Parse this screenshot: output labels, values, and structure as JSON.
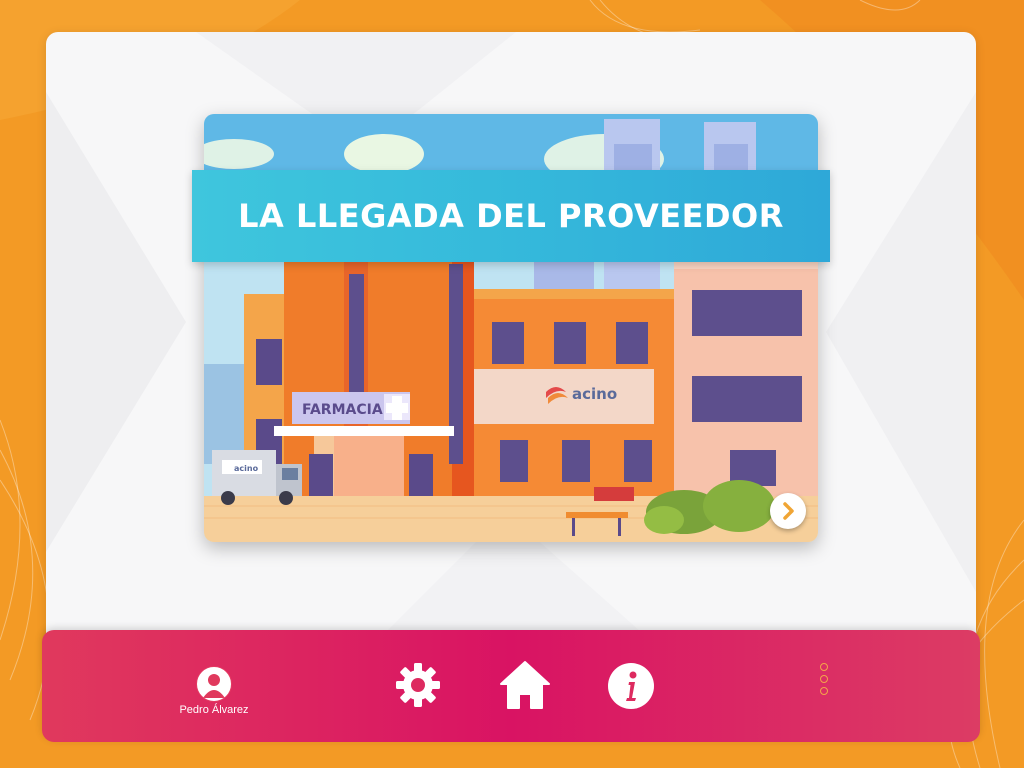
{
  "card": {
    "title": "LA LLEGADA DEL PROVEEDOR",
    "pharmacy_sign": "FARMACIA",
    "company_sign": "acino",
    "truck_sign": "acino"
  },
  "footer": {
    "user_name": "Pedro Álvarez"
  },
  "icons": {
    "avatar": "user-avatar-icon",
    "settings": "gear-icon",
    "home": "home-icon",
    "info": "info-icon",
    "next": "chevron-right-icon",
    "menu": "vertical-dots-icon"
  },
  "colors": {
    "background": "#f39a25",
    "banner": "#35b9db",
    "footer": "#d91363",
    "panel": "#f7f7f8"
  }
}
